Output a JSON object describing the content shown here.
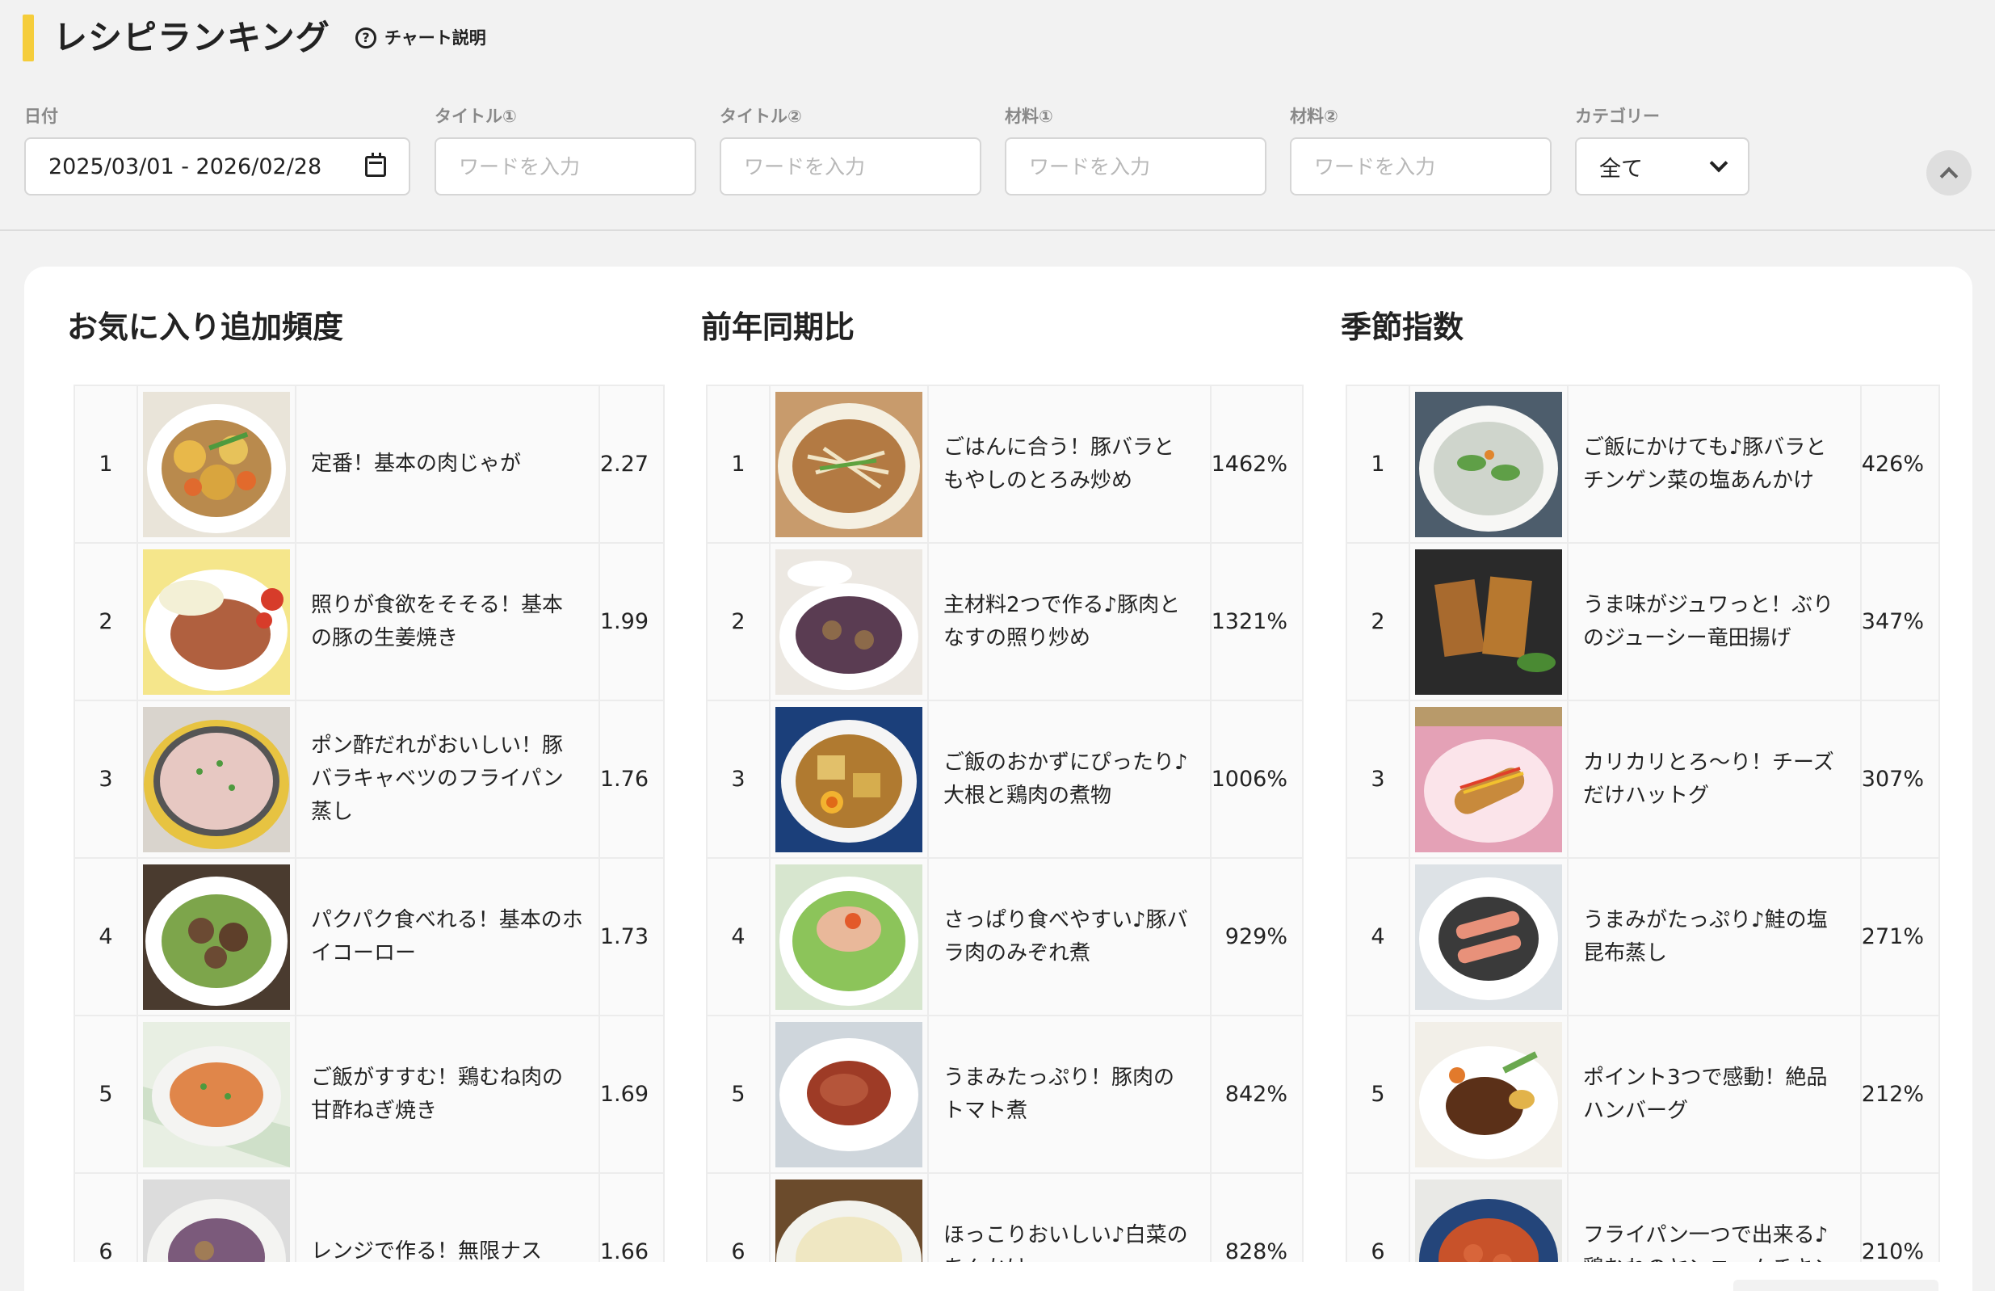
{
  "header": {
    "title": "レシピランキング",
    "help_label": "チャート説明"
  },
  "filters": {
    "date_label": "日付",
    "date_value": "2025/03/01 - 2026/02/28",
    "title1_label": "タイトル①",
    "title2_label": "タイトル②",
    "ingredient1_label": "材料①",
    "ingredient2_label": "材料②",
    "category_label": "カテゴリー",
    "category_value": "全て",
    "placeholder": "ワードを入力"
  },
  "sections": [
    {
      "title": "お気に入り追加頻度",
      "rows": [
        {
          "rank": "1",
          "name": "定番！基本の肉じゃが",
          "value": "2.27"
        },
        {
          "rank": "2",
          "name": "照りが食欲をそそる！基本の豚の生姜焼き",
          "value": "1.99"
        },
        {
          "rank": "3",
          "name": "ポン酢だれがおいしい！豚バラキャベツのフライパン蒸し",
          "value": "1.76"
        },
        {
          "rank": "4",
          "name": "パクパク食べれる！基本のホイコーロー",
          "value": "1.73"
        },
        {
          "rank": "5",
          "name": "ご飯がすすむ！鶏むね肉の甘酢ねぎ焼き",
          "value": "1.69"
        },
        {
          "rank": "6",
          "name": "レンジで作る！無限ナス",
          "value": "1.66"
        }
      ]
    },
    {
      "title": "前年同期比",
      "rows": [
        {
          "rank": "1",
          "name": "ごはんに合う！豚バラともやしのとろみ炒め",
          "value": "1462%"
        },
        {
          "rank": "2",
          "name": "主材料2つで作る♪豚肉となすの照り炒め",
          "value": "1321%"
        },
        {
          "rank": "3",
          "name": "ご飯のおかずにぴったり♪大根と鶏肉の煮物",
          "value": "1006%"
        },
        {
          "rank": "4",
          "name": "さっぱり食べやすい♪豚バラ肉のみぞれ煮",
          "value": "929%"
        },
        {
          "rank": "5",
          "name": "うまみたっぷり！豚肉のトマト煮",
          "value": "842%"
        },
        {
          "rank": "6",
          "name": "ほっこりおいしい♪白菜のあんかけ",
          "value": "828%"
        }
      ]
    },
    {
      "title": "季節指数",
      "rows": [
        {
          "rank": "1",
          "name": "ご飯にかけても♪豚バラとチンゲン菜の塩あんかけ",
          "value": "426%"
        },
        {
          "rank": "2",
          "name": "うま味がジュワっと！ぶりのジューシー竜田揚げ",
          "value": "347%"
        },
        {
          "rank": "3",
          "name": "カリカリとろ〜り！チーズだけハットグ",
          "value": "307%"
        },
        {
          "rank": "4",
          "name": "うまみがたっぷり♪鮭の塩昆布蒸し",
          "value": "271%"
        },
        {
          "rank": "5",
          "name": "ポイント3つで感動！絶品ハンバーグ",
          "value": "212%"
        },
        {
          "rank": "6",
          "name": "フライパン一つで出来る♪鶏むねのヤンニョムチキン",
          "value": "210%"
        }
      ]
    }
  ],
  "colors": {
    "accent": "#f5cd3b",
    "background": "#f2f2f2",
    "card": "#ffffff",
    "border": "#ececec"
  }
}
